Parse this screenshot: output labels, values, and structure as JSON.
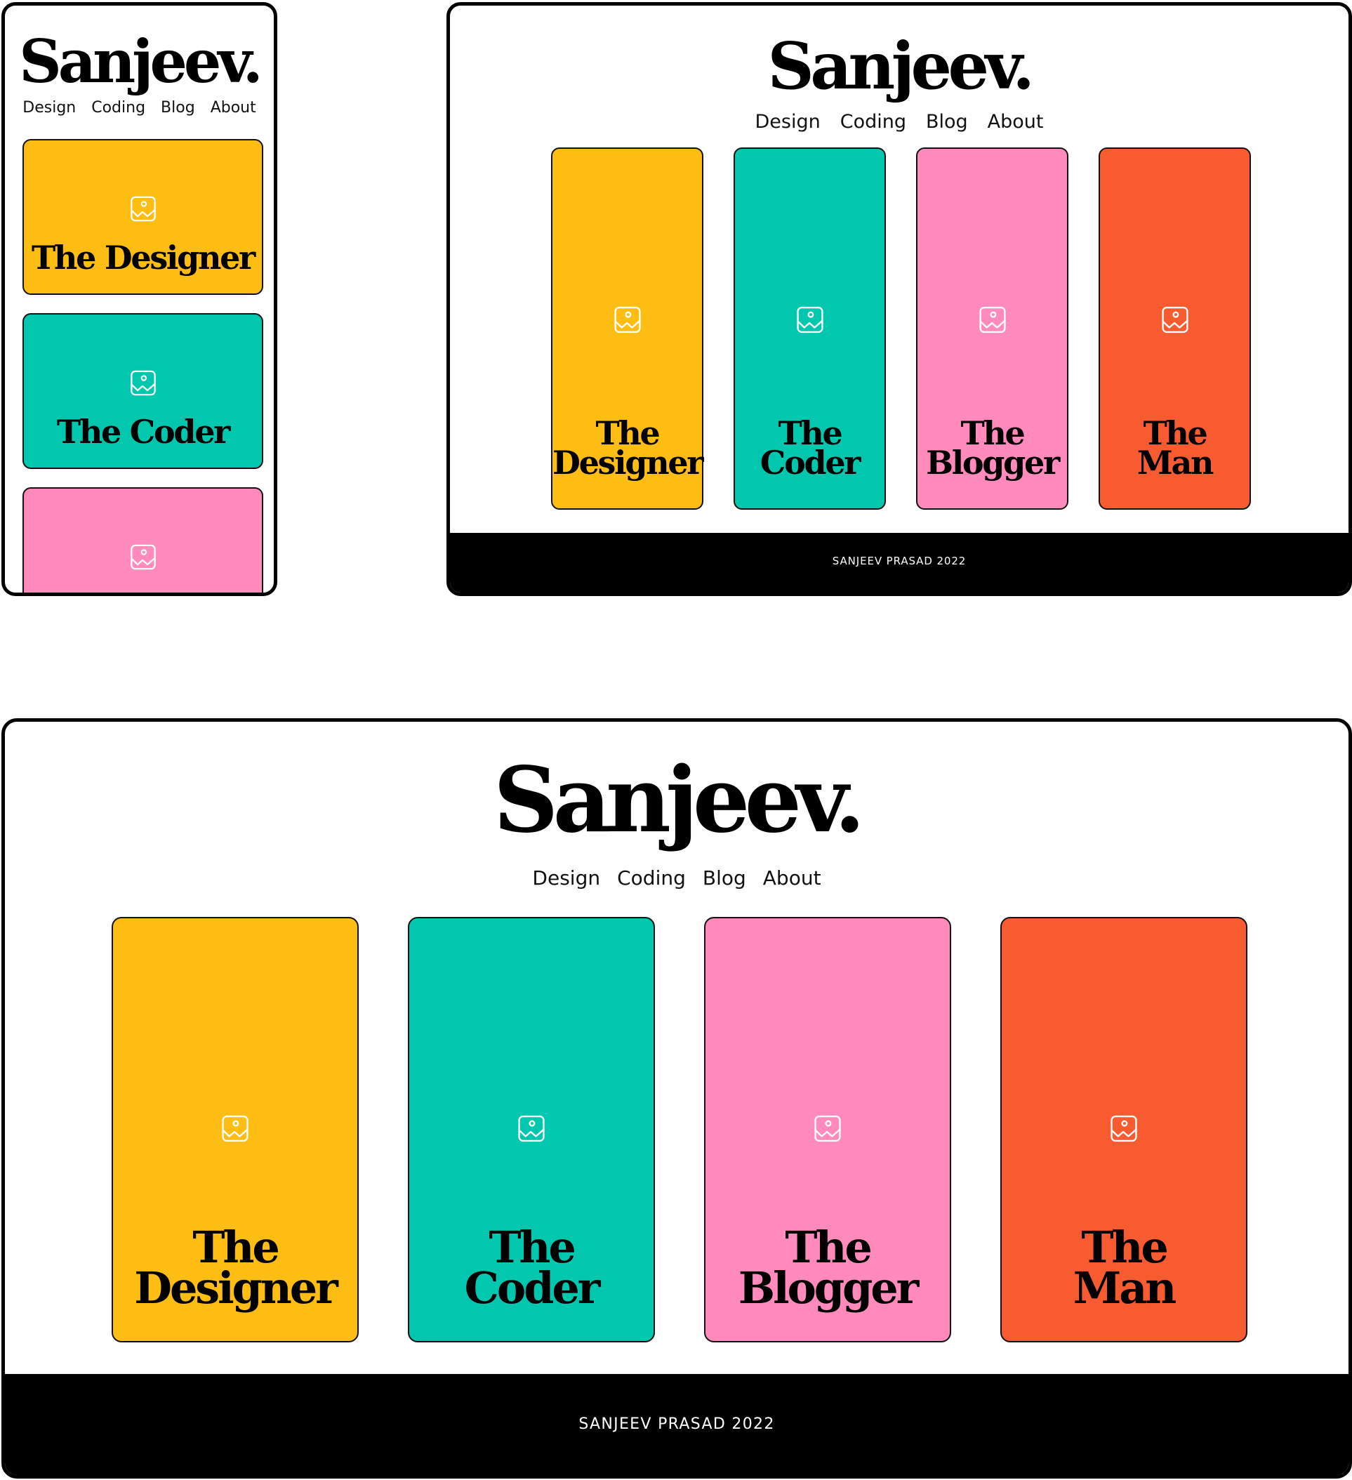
{
  "brand": "Sanjeev.",
  "nav": [
    "Design",
    "Coding",
    "Blog",
    "About"
  ],
  "cards": [
    {
      "line1": "The",
      "line2": "Designer",
      "full": "The Designer",
      "color": "#FDBD13"
    },
    {
      "line1": "The",
      "line2": "Coder",
      "full": "The Coder",
      "color": "#00C7AE"
    },
    {
      "line1": "The",
      "line2": "Blogger",
      "full": "The Blogger",
      "color": "#FF8ABB"
    },
    {
      "line1": "The",
      "line2": "Man",
      "full": "The Man",
      "color": "#F95B30"
    }
  ],
  "footer": "SANJEEV PRASAD 2022",
  "icon": "image-placeholder-icon"
}
